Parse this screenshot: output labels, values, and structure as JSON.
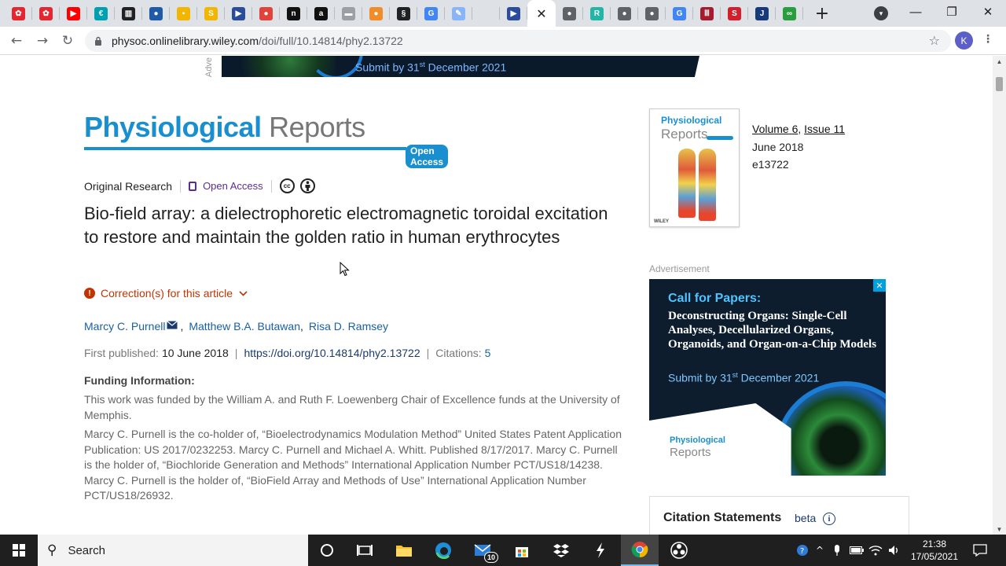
{
  "browser": {
    "tabs": [
      {
        "icon": "pinwheel-red-icon",
        "color": "#e3262f",
        "glyph": "✿"
      },
      {
        "icon": "pinwheel-red-icon",
        "color": "#e3262f",
        "glyph": "✿"
      },
      {
        "icon": "youtube-icon",
        "color": "#ff0000",
        "glyph": "▶"
      },
      {
        "icon": "euro-icon",
        "color": "#00a0b0",
        "glyph": "€"
      },
      {
        "icon": "institution-icon",
        "color": "#202124",
        "glyph": "▥"
      },
      {
        "icon": "globe-icon",
        "color": "#1e5aa8",
        "glyph": "●"
      },
      {
        "icon": "yellow-square-icon",
        "color": "#f2b600",
        "glyph": "▪"
      },
      {
        "icon": "s-icon",
        "color": "#f2b600",
        "glyph": "S"
      },
      {
        "icon": "flag-icon",
        "color": "#2a4c9a",
        "glyph": "▶"
      },
      {
        "icon": "map-pin-icon",
        "color": "#e0433b",
        "glyph": "●"
      },
      {
        "icon": "n-icon",
        "color": "#111111",
        "glyph": "n"
      },
      {
        "icon": "amazon-icon",
        "color": "#111111",
        "glyph": "a"
      },
      {
        "icon": "news-icon",
        "color": "#9aa0a6",
        "glyph": "▬"
      },
      {
        "icon": "orange-circle-icon",
        "color": "#f28c28",
        "glyph": "●"
      },
      {
        "icon": "swirl-icon",
        "color": "#202124",
        "glyph": "§"
      },
      {
        "icon": "google-icon",
        "color": "#4285f4",
        "glyph": "G"
      },
      {
        "icon": "feather-icon",
        "color": "#8ab4f8",
        "glyph": "✎"
      },
      {
        "icon": "blank-icon",
        "color": "#dee1e6",
        "glyph": ""
      },
      {
        "icon": "flag-icon",
        "color": "#2a4c9a",
        "glyph": "▶"
      },
      {
        "icon": "close-icon",
        "color": "#202124",
        "glyph": "✕",
        "active": true
      },
      {
        "icon": "globe-grey-icon",
        "color": "#5f6368",
        "glyph": "●"
      },
      {
        "icon": "r-square-icon",
        "color": "#23b5a5",
        "glyph": "R"
      },
      {
        "icon": "globe-grey-icon",
        "color": "#5f6368",
        "glyph": "●"
      },
      {
        "icon": "globe-grey-icon",
        "color": "#5f6368",
        "glyph": "●"
      },
      {
        "icon": "google-icon",
        "color": "#4285f4",
        "glyph": "G"
      },
      {
        "icon": "bars-icon",
        "color": "#a51c30",
        "glyph": "Ⅲ"
      },
      {
        "icon": "s-red-icon",
        "color": "#d21f2b",
        "glyph": "S"
      },
      {
        "icon": "j-icon",
        "color": "#173a7a",
        "glyph": "J"
      },
      {
        "icon": "rings-icon",
        "color": "#2a9d3f",
        "glyph": "∞"
      }
    ],
    "url_domain": "physoc.onlinelibrary.wiley.com",
    "url_path": "/doi/full/10.14814/phy2.13722",
    "profile_initial": "K"
  },
  "page": {
    "banner_ad": {
      "text": "Submit by 31",
      "sup": "st",
      "text_after": " December 2021",
      "side_label": "Adve"
    },
    "logo": {
      "main": "Physiological",
      "second": "Reports",
      "badge": "Open Access"
    },
    "article_type": "Original Research",
    "open_access": "Open Access",
    "cc_label": "cc",
    "title": "Bio-field array: a dielectrophoretic electromagnetic toroidal excitation to restore and maintain the golden ratio in human erythrocytes",
    "correction": "Correction(s) for this article",
    "authors": [
      "Marcy C. Purnell",
      "Matthew B.A. Butawan",
      "Risa D. Ramsey"
    ],
    "published_label": "First published:",
    "published_date": "10 June 2018",
    "doi": "https://doi.org/10.14814/phy2.13722",
    "citations_label": "Citations:",
    "citations_count": "5",
    "funding_heading": "Funding Information:",
    "funding_p1": "This work was funded by the William A. and Ruth F. Loewenberg Chair of Excellence funds at the University of Memphis.",
    "funding_p2": "Marcy C. Purnell is the co-holder of, “Bioelectrodynamics Modulation Method” United States Patent Application Publication: US 2017/0232253. Marcy C. Purnell and Michael A. Whitt. Published 8/17/2017. Marcy C. Purnell is the holder of, “Biochloride Generation and Methods” International Application Number PCT/US18/14238. Marcy C. Purnell is the holder of, “BioField Array and Methods of Use” International Application Number PCT/US18/26932."
  },
  "sidebar": {
    "cover": {
      "title1": "Physiological",
      "title2": "Reports",
      "publisher": "WILEY"
    },
    "volume_label": "Volume",
    "volume": "6",
    "issue_label": "Issue",
    "issue": "11",
    "date": "June 2018",
    "article_id": "e13722",
    "advert_label": "Advertisement",
    "ad": {
      "kicker": "Call for Papers:",
      "headline": "Deconstructing Organs: Single-Cell Analyses, Decellularized Organs, Organoids, and Organ-on-a-Chip Models",
      "sub": "Submit by 31",
      "sub_sup": "st",
      "sub_after": " December 2021",
      "logo1": "Physiological",
      "logo2": "Reports"
    },
    "citation_statements": "Citation Statements",
    "beta": "beta"
  },
  "taskbar": {
    "search_label": "Search",
    "mail_badge": "10",
    "time": "21:38",
    "date": "17/05/2021"
  },
  "colors": {
    "journal_blue": "#1a8fd0",
    "link_blue": "#1a5fa5",
    "correction_red": "#c23300",
    "open_access_purple": "#5c2d91"
  }
}
